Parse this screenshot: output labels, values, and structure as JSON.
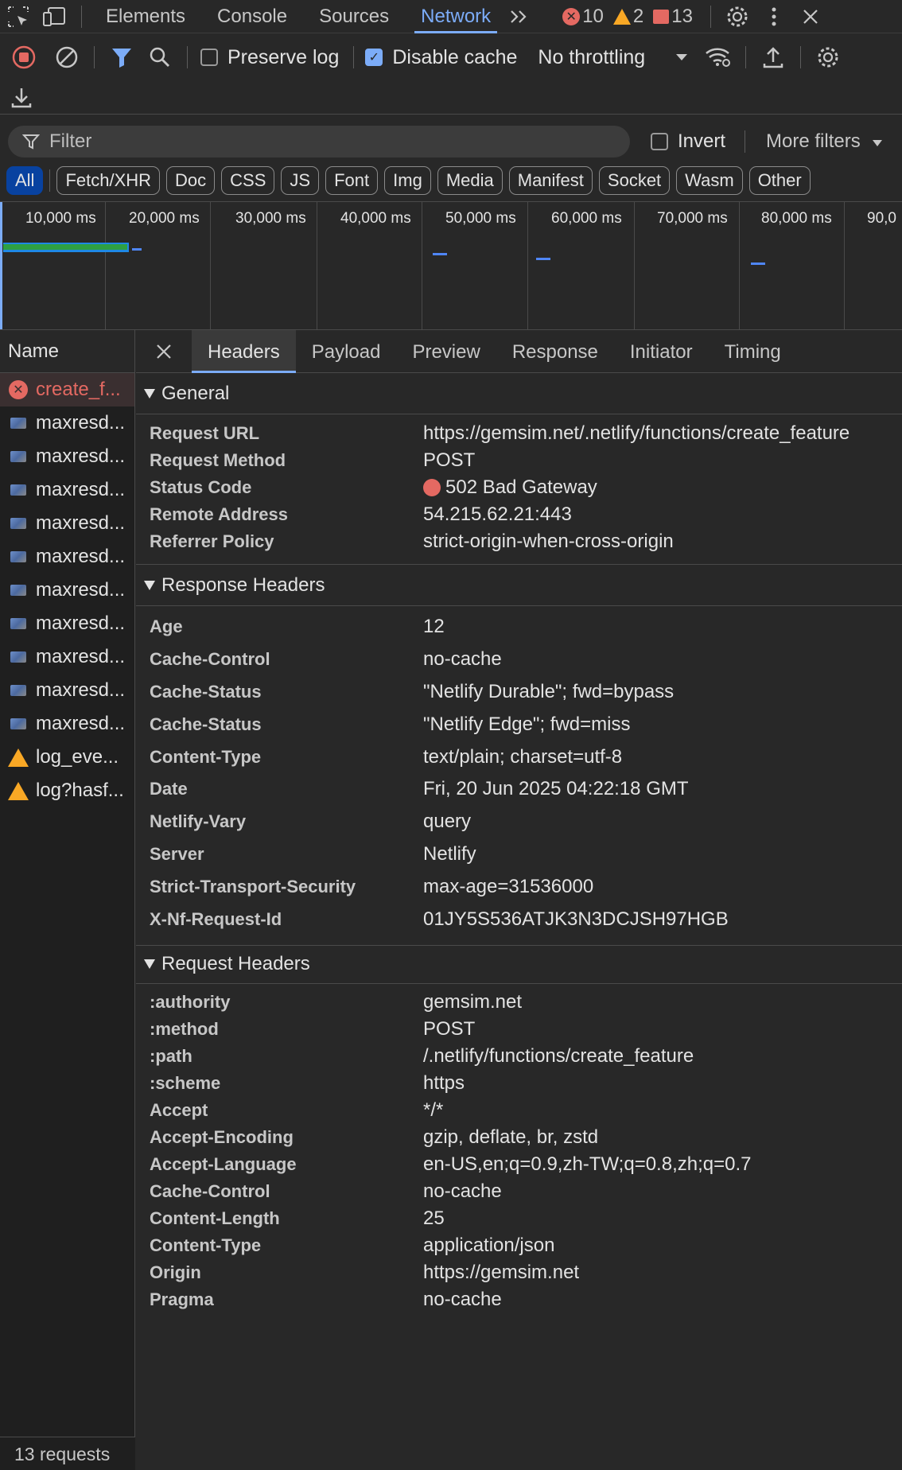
{
  "topbar": {
    "tabs": [
      "Elements",
      "Console",
      "Sources",
      "Network"
    ],
    "active_tab": "Network",
    "errors": "10",
    "warnings": "2",
    "issues": "13"
  },
  "toolbar": {
    "preserve_log": "Preserve log",
    "disable_cache": "Disable cache",
    "throttling": "No throttling"
  },
  "filter": {
    "placeholder": "Filter",
    "invert": "Invert",
    "more_filters": "More filters"
  },
  "chips": [
    "All",
    "Fetch/XHR",
    "Doc",
    "CSS",
    "JS",
    "Font",
    "Img",
    "Media",
    "Manifest",
    "Socket",
    "Wasm",
    "Other"
  ],
  "overview": {
    "ticks": [
      "10,000 ms",
      "20,000 ms",
      "30,000 ms",
      "40,000 ms",
      "50,000 ms",
      "60,000 ms",
      "70,000 ms",
      "80,000 ms",
      "90,0"
    ]
  },
  "requests": {
    "header": "Name",
    "items": [
      {
        "name": "create_f...",
        "type": "error"
      },
      {
        "name": "maxresd...",
        "type": "img"
      },
      {
        "name": "maxresd...",
        "type": "img"
      },
      {
        "name": "maxresd...",
        "type": "img"
      },
      {
        "name": "maxresd...",
        "type": "img"
      },
      {
        "name": "maxresd...",
        "type": "img"
      },
      {
        "name": "maxresd...",
        "type": "img"
      },
      {
        "name": "maxresd...",
        "type": "img"
      },
      {
        "name": "maxresd...",
        "type": "img"
      },
      {
        "name": "maxresd...",
        "type": "img"
      },
      {
        "name": "maxresd...",
        "type": "img"
      },
      {
        "name": "log_eve...",
        "type": "warn"
      },
      {
        "name": "log?hasf...",
        "type": "warn"
      }
    ],
    "footer": "13 requests"
  },
  "detail": {
    "tabs": [
      "Headers",
      "Payload",
      "Preview",
      "Response",
      "Initiator",
      "Timing"
    ],
    "active_tab": "Headers",
    "general": {
      "title": "General",
      "rows": [
        {
          "k": "Request URL",
          "v": "https://gemsim.net/.netlify/functions/create_feature"
        },
        {
          "k": "Request Method",
          "v": "POST"
        },
        {
          "k": "Status Code",
          "v": "502 Bad Gateway"
        },
        {
          "k": "Remote Address",
          "v": "54.215.62.21:443"
        },
        {
          "k": "Referrer Policy",
          "v": "strict-origin-when-cross-origin"
        }
      ]
    },
    "response_headers": {
      "title": "Response Headers",
      "rows": [
        {
          "k": "Age",
          "v": "12"
        },
        {
          "k": "Cache-Control",
          "v": "no-cache"
        },
        {
          "k": "Cache-Status",
          "v": "\"Netlify Durable\"; fwd=bypass"
        },
        {
          "k": "Cache-Status",
          "v": "\"Netlify Edge\"; fwd=miss"
        },
        {
          "k": "Content-Type",
          "v": "text/plain; charset=utf-8"
        },
        {
          "k": "Date",
          "v": "Fri, 20 Jun 2025 04:22:18 GMT"
        },
        {
          "k": "Netlify-Vary",
          "v": "query"
        },
        {
          "k": "Server",
          "v": "Netlify"
        },
        {
          "k": "Strict-Transport-Security",
          "v": "max-age=31536000"
        },
        {
          "k": "X-Nf-Request-Id",
          "v": "01JY5S536ATJK3N3DCJSH97HGB"
        }
      ]
    },
    "request_headers": {
      "title": "Request Headers",
      "rows": [
        {
          "k": ":authority",
          "v": "gemsim.net"
        },
        {
          "k": ":method",
          "v": "POST"
        },
        {
          "k": ":path",
          "v": "/.netlify/functions/create_feature"
        },
        {
          "k": ":scheme",
          "v": "https"
        },
        {
          "k": "Accept",
          "v": "*/*"
        },
        {
          "k": "Accept-Encoding",
          "v": "gzip, deflate, br, zstd"
        },
        {
          "k": "Accept-Language",
          "v": "en-US,en;q=0.9,zh-TW;q=0.8,zh;q=0.7"
        },
        {
          "k": "Cache-Control",
          "v": "no-cache"
        },
        {
          "k": "Content-Length",
          "v": "25"
        },
        {
          "k": "Content-Type",
          "v": "application/json"
        },
        {
          "k": "Origin",
          "v": "https://gemsim.net"
        },
        {
          "k": "Pragma",
          "v": "no-cache"
        }
      ]
    }
  },
  "colors": {
    "accent": "#7cacf8",
    "error": "#e46962",
    "warning": "#f9a825"
  }
}
